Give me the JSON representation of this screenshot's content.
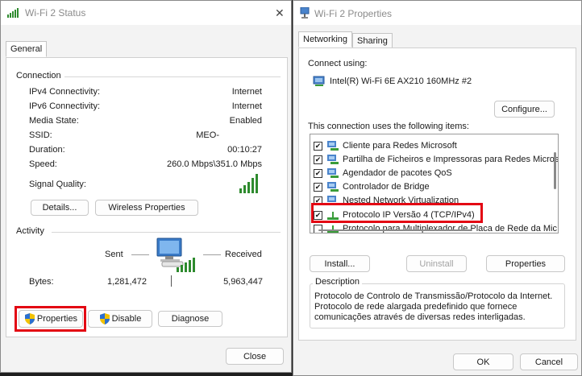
{
  "status_window": {
    "title": "Wi-Fi 2 Status",
    "tab_general": "General",
    "connection": {
      "heading": "Connection",
      "rows": [
        {
          "label": "IPv4 Connectivity:",
          "value": "Internet"
        },
        {
          "label": "IPv6 Connectivity:",
          "value": "Internet"
        },
        {
          "label": "Media State:",
          "value": "Enabled"
        },
        {
          "label": "SSID:",
          "value": "MEO-"
        },
        {
          "label": "Duration:",
          "value": "00:10:27"
        },
        {
          "label": "Speed:",
          "value": "260.0 Mbps\\351.0 Mbps"
        }
      ],
      "signal_label": "Signal Quality:"
    },
    "details_button": "Details...",
    "wireless_button": "Wireless Properties",
    "activity": {
      "heading": "Activity",
      "sent_label": "Sent",
      "received_label": "Received",
      "bytes_label": "Bytes:",
      "bytes_sent": "1,281,472",
      "bytes_received": "5,963,447"
    },
    "properties_button": "Properties",
    "disable_button": "Disable",
    "diagnose_button": "Diagnose",
    "close_button": "Close"
  },
  "properties_window": {
    "title": "Wi-Fi 2 Properties",
    "tab_networking": "Networking",
    "tab_sharing": "Sharing",
    "connect_using_label": "Connect using:",
    "adapter_name": "Intel(R) Wi-Fi 6E AX210 160MHz #2",
    "configure_button": "Configure...",
    "items_label": "This connection uses the following items:",
    "items": [
      {
        "label": "Cliente para Redes Microsoft",
        "checked": true
      },
      {
        "label": "Partilha de Ficheiros e Impressoras para Redes Microso",
        "checked": true
      },
      {
        "label": "Agendador de pacotes QoS",
        "checked": true
      },
      {
        "label": "Controlador de Bridge",
        "checked": true
      },
      {
        "label": "Nested Network Virtualization",
        "checked": true
      },
      {
        "label": "Protocolo IP Versão 4 (TCP/IPv4)",
        "checked": true
      },
      {
        "label": "Protocolo para Multiplexador de Placa de Rede da Mic",
        "checked": false
      }
    ],
    "install_button": "Install...",
    "uninstall_button": "Uninstall",
    "item_properties_button": "Properties",
    "description_heading": "Description",
    "description_lines": [
      "Protocolo de Controlo de Transmissão/Protocolo da Internet.",
      "Protocolo de rede alargada predefinido que fornece",
      "comunicações através de diversas redes interligadas."
    ],
    "ok_button": "OK",
    "cancel_button": "Cancel"
  },
  "colors": {
    "highlight_red": "#e30613",
    "signal_green": "#2e8b2e",
    "window_bg": "#f3f3f3"
  }
}
